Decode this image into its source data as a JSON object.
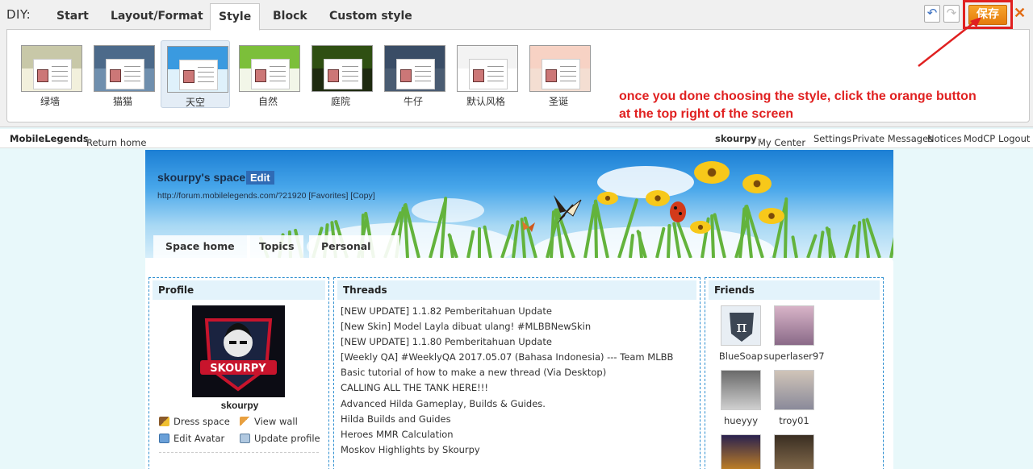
{
  "diy": {
    "title": "DIY:",
    "tabs": [
      "Start",
      "Layout/Format",
      "Style",
      "Block",
      "Custom style"
    ],
    "active_tab": "Style",
    "styles": [
      {
        "label": "绿墙",
        "header_color": "#c8c8a8",
        "bg": "#f2f0dc"
      },
      {
        "label": "猫猫",
        "header_color": "#4c6a8a",
        "bg": "#6f8fae"
      },
      {
        "label": "天空",
        "header_color": "#3a9ae0",
        "bg": "#dff1fb",
        "selected": true
      },
      {
        "label": "自然",
        "header_color": "#7cbf3a",
        "bg": "#f2f6e8"
      },
      {
        "label": "庭院",
        "header_color": "#2f4f12",
        "bg": "#1e2a10"
      },
      {
        "label": "牛仔",
        "header_color": "#3a4d66",
        "bg": "#4a5c72"
      },
      {
        "label": "默认风格",
        "header_color": "#f3f3f3",
        "bg": "#ffffff"
      },
      {
        "label": "圣诞",
        "header_color": "#f7d2c4",
        "bg": "#f4ded2"
      }
    ],
    "save_label": "保存",
    "undo_icon": "↶",
    "redo_icon": "↷",
    "close_icon": "✕",
    "note_line1": "once you done choosing the style, click the orange button",
    "note_line2": "at the top right of the screen",
    "note_color": "#e02020"
  },
  "topnav": {
    "site": "MobileLegends",
    "return_home": "Return home",
    "user": "skourpy",
    "my_center": "My Center",
    "settings": "Settings",
    "pm": "Private Messages",
    "notices": "Notices",
    "modcp": "ModCP",
    "logout": "Logout"
  },
  "space": {
    "name": "skourpy's space",
    "edit": "Edit",
    "url": "http://forum.mobilelegends.com/?21920 [Favorites] [Copy]",
    "tabs": [
      "Space home",
      "Topics",
      "Personal Info"
    ]
  },
  "profile": {
    "heading": "Profile",
    "avatar_text": "SKOURPY",
    "name": "skourpy",
    "links": [
      "Dress space",
      "View wall",
      "Edit Avatar",
      "Update profile"
    ]
  },
  "threads": {
    "heading": "Threads",
    "items": [
      "[NEW UPDATE] 1.1.82 Pemberitahuan Update",
      "[New Skin] Model Layla dibuat ulang! #MLBBNewSkin",
      "[NEW UPDATE] 1.1.80 Pemberitahuan Update",
      "[Weekly QA] #WeeklyQA 2017.05.07 (Bahasa Indonesia) --- Team MLBB",
      "Basic tutorial of how to make a new thread (Via Desktop)",
      "CALLING ALL THE TANK HERE!!!",
      "Advanced Hilda Gameplay, Builds & Guides.",
      "Hilda Builds and Guides",
      "Heroes MMR Calculation",
      "Moskov Highlights by Skourpy"
    ]
  },
  "friends": {
    "heading": "Friends",
    "items": [
      "BlueSoap",
      "superlaser97",
      "hueyyy",
      "troy01"
    ]
  }
}
